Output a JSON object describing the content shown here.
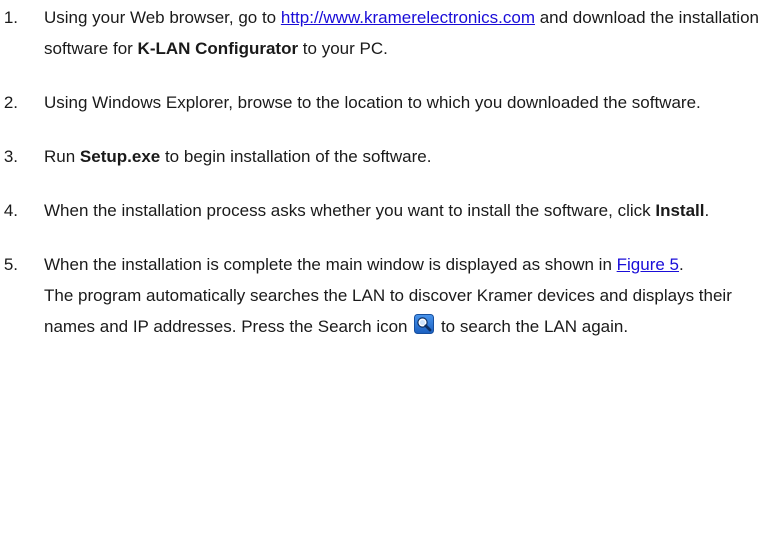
{
  "steps": [
    {
      "number": "1.",
      "text_before": "Using your Web browser, go to ",
      "link": "http://www.kramerelectronics.com",
      "text_middle": " and download the installation software for ",
      "bold": "K-LAN Configurator",
      "text_after": " to your PC."
    },
    {
      "number": "2.",
      "text": "Using Windows Explorer, browse to the location to which you downloaded the software."
    },
    {
      "number": "3.",
      "text_before": "Run ",
      "bold": "Setup.exe",
      "text_after": " to begin installation of the software."
    },
    {
      "number": "4.",
      "text_before": "When the installation process asks whether you want to install the software, click ",
      "bold": "Install",
      "text_after": "."
    },
    {
      "number": "5.",
      "text_before": "When the installation is complete the main window is displayed as shown in ",
      "link": "Figure 5",
      "text_after": ".",
      "note_before": "The program automatically searches the LAN to discover Kramer devices and displays their names and IP addresses. Press the Search icon ",
      "note_icon": "search-icon",
      "note_after": " to search the LAN again."
    }
  ],
  "colors": {
    "link": "#1a0dd8",
    "text": "#1a1a1a",
    "icon_bg": "#1f6fd1"
  }
}
